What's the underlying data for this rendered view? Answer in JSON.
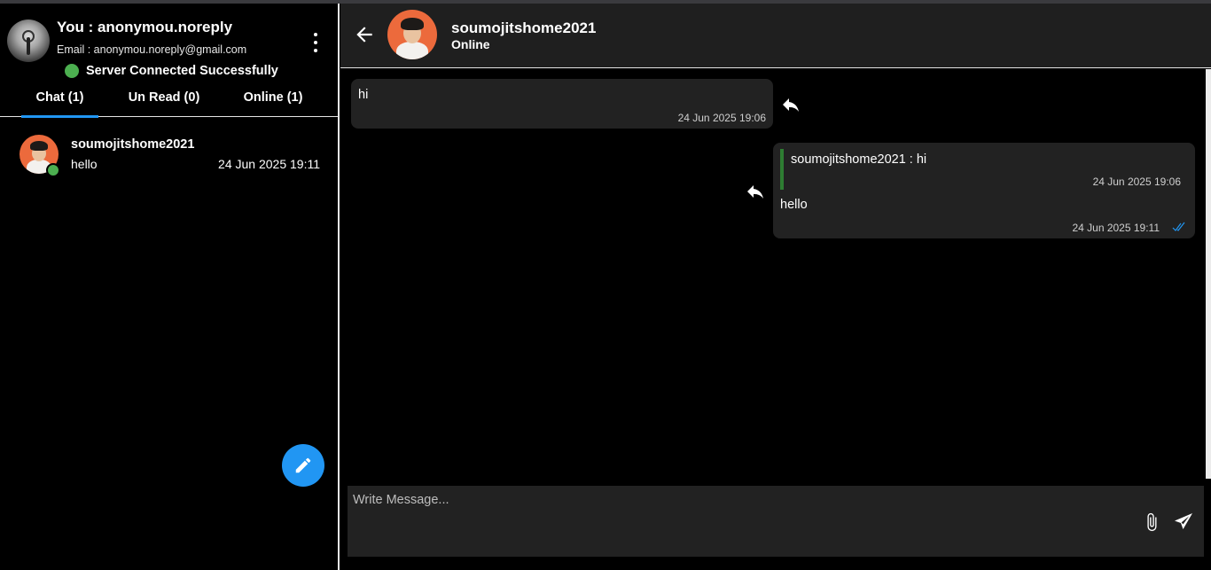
{
  "user": {
    "title": "You : anonymou.noreply",
    "email": "Email : anonymou.noreply@gmail.com",
    "avatar_icon": "user-avatar",
    "menu_icon": "kebab-menu-icon"
  },
  "server_status": {
    "text": "Server Connected Successfully",
    "color": "#4caf50"
  },
  "tabs": [
    {
      "label": "Chat (1)",
      "active": true
    },
    {
      "label": "Un Read (0)",
      "active": false
    },
    {
      "label": "Online (1)",
      "active": false
    }
  ],
  "chat_list": [
    {
      "name": "soumojitshome2021",
      "last_message": "hello",
      "time": "24 Jun 2025 19:11",
      "online": true
    }
  ],
  "fab_icon": "pencil-icon",
  "conversation": {
    "contact_name": "soumojitshome2021",
    "contact_status": "Online",
    "back_icon": "arrow-left-icon",
    "messages": [
      {
        "direction": "incoming",
        "text": "hi",
        "time": "24 Jun 2025 19:06"
      },
      {
        "direction": "outgoing",
        "quote": {
          "text": "soumojitshome2021 : hi",
          "time": "24 Jun 2025 19:06"
        },
        "text": "hello",
        "time": "24 Jun 2025 19:11",
        "status": "double-check-icon"
      }
    ]
  },
  "composer": {
    "placeholder": "Write Message...",
    "value": "",
    "attach_icon": "paperclip-icon",
    "send_icon": "send-icon"
  },
  "colors": {
    "accent": "#2196f3",
    "online": "#4caf50",
    "quote_bar": "#2e7d32",
    "bubble": "#222222"
  }
}
